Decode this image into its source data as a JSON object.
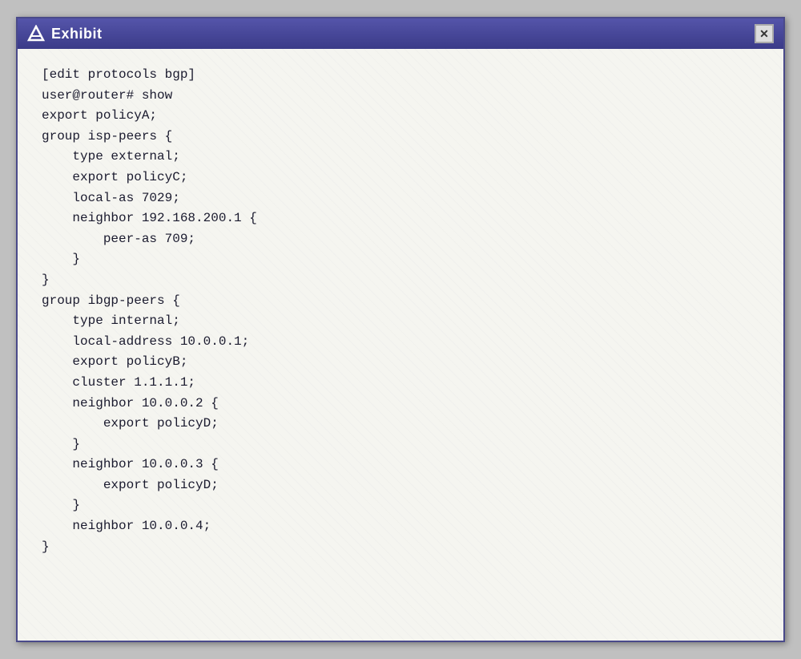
{
  "window": {
    "title": "Exhibit",
    "close_label": "✕"
  },
  "code": {
    "lines": [
      "[edit protocols bgp]",
      "user@router# show",
      "export policyA;",
      "group isp-peers {",
      "    type external;",
      "    export policyC;",
      "    local-as 7029;",
      "    neighbor 192.168.200.1 {",
      "        peer-as 709;",
      "    }",
      "}",
      "group ibgp-peers {",
      "    type internal;",
      "    local-address 10.0.0.1;",
      "    export policyB;",
      "    cluster 1.1.1.1;",
      "    neighbor 10.0.0.2 {",
      "        export policyD;",
      "    }",
      "    neighbor 10.0.0.3 {",
      "        export policyD;",
      "    }",
      "    neighbor 10.0.0.4;",
      "}"
    ]
  },
  "icons": {
    "app_icon": "⬡",
    "close_icon": "✕"
  },
  "colors": {
    "title_bar_start": "#5555aa",
    "title_bar_end": "#3a3a88",
    "text_color": "#1a1a2e",
    "background": "#f5f5f0"
  }
}
